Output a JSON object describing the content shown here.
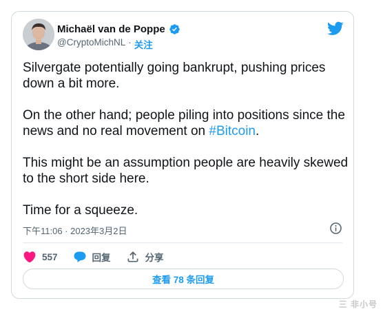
{
  "author": {
    "name": "Michaël van de Poppe",
    "handle": "@CryptoMichNL",
    "separator": "·",
    "follow_label": "关注"
  },
  "icons": {
    "verified": "verified-badge-icon",
    "logo": "twitter-bird-icon",
    "info": "info-icon",
    "like": "heart-icon",
    "reply": "reply-bubble-icon",
    "share": "share-icon"
  },
  "tweet": {
    "paragraph_1": "Silvergate potentially going bankrupt, pushing prices down a bit more.",
    "paragraph_2_before": "On the other hand; people piling into positions since the news and no real movement on ",
    "hashtag": "#Bitcoin",
    "paragraph_2_after": ".",
    "paragraph_3": "This might be an assumption people are heavily skewed to the short side here.",
    "paragraph_4": "Time for a squeeze.",
    "timestamp": "下午11:06 · 2023年3月2日"
  },
  "actions": {
    "like_count": "557",
    "reply_label": "回复",
    "share_label": "分享"
  },
  "replies_button_label": "查看 78 条回复",
  "watermark": "三 非小号",
  "colors": {
    "accent": "#1d9bf0",
    "like": "#f91880",
    "text": "#0f1419",
    "muted": "#536471",
    "border": "#cfd9de"
  }
}
